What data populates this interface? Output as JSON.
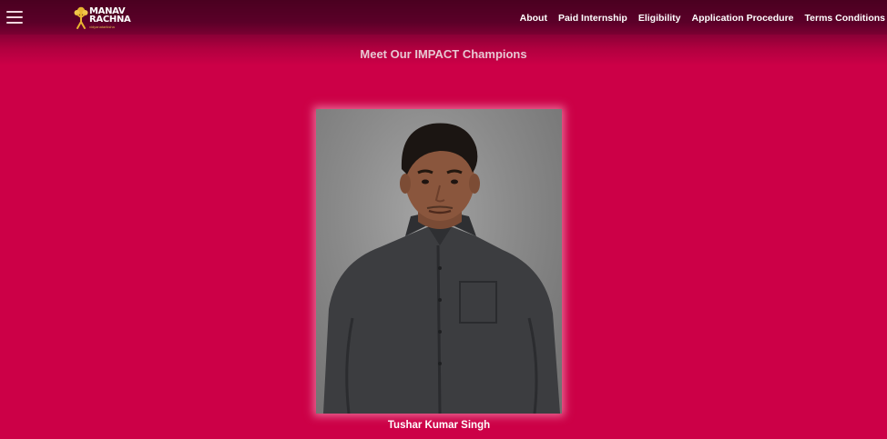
{
  "header": {
    "logo": {
      "line1": "MANAV",
      "line2": "RACHNA",
      "tagline": "vidyanatariksha"
    },
    "menu_icon": "hamburger-icon",
    "nav": [
      {
        "label": "About"
      },
      {
        "label": "Paid Internship"
      },
      {
        "label": "Eligibility"
      },
      {
        "label": "Application Procedure"
      },
      {
        "label": "Terms Conditions"
      }
    ]
  },
  "main": {
    "heading": "Meet Our IMPACT Champions",
    "champion": {
      "name": "Tushar Kumar Singh"
    }
  },
  "colors": {
    "background": "#cc0047",
    "header": "#4a0020",
    "accent_gold": "#d9b44a"
  }
}
